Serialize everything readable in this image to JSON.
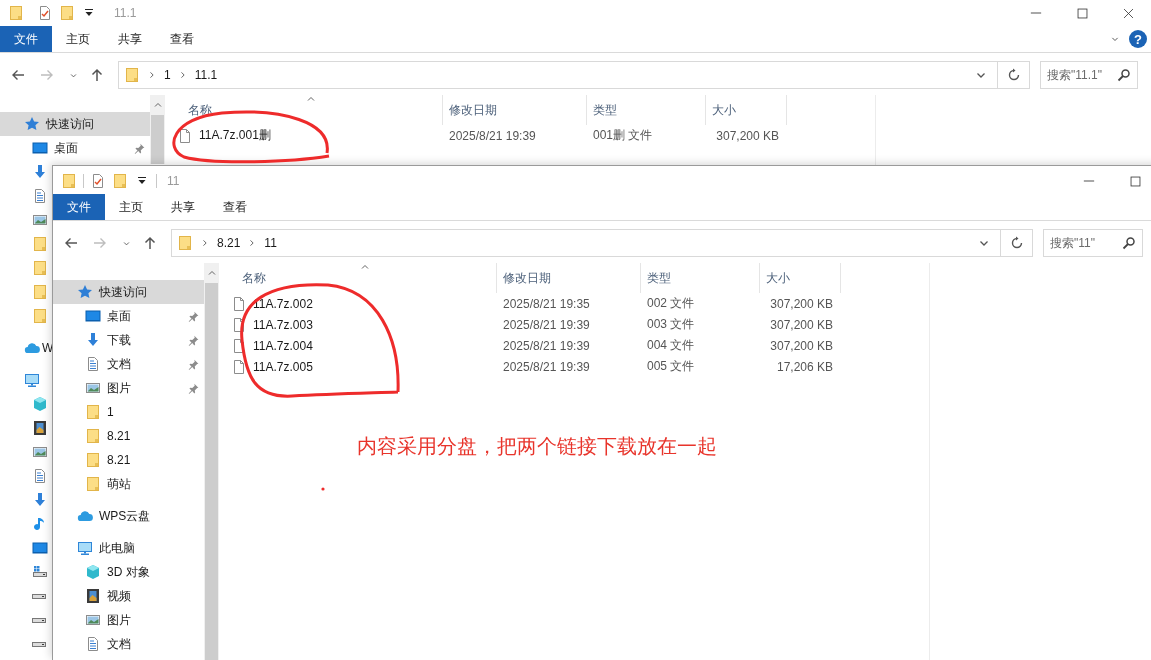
{
  "windows": [
    {
      "title": "11.1",
      "controls": [
        {
          "kind": "minimize"
        },
        {
          "kind": "maximize"
        },
        {
          "kind": "close"
        }
      ],
      "ribbon_tabs": [
        {
          "label": "文件",
          "selected": true
        },
        {
          "label": "主页",
          "selected": false
        },
        {
          "label": "共享",
          "selected": false
        },
        {
          "label": "查看",
          "selected": false
        }
      ],
      "help": "?",
      "address": [
        "1",
        "11.1"
      ],
      "search": {
        "placeholder": "搜索\"11.1\""
      },
      "nav": [
        {
          "kind": "star",
          "label": "快速访问",
          "selected": true,
          "children": [
            {
              "kind": "desktop",
              "label": "桌面",
              "pinned": true,
              "selected": false
            },
            {
              "kind": "download",
              "selected": false
            },
            {
              "kind": "doc",
              "selected": false
            },
            {
              "kind": "picture",
              "selected": false
            },
            {
              "kind": "folder",
              "selected": false
            },
            {
              "kind": "folder",
              "selected": false
            },
            {
              "kind": "folder",
              "selected": false
            },
            {
              "kind": "folder",
              "selected": false
            }
          ]
        },
        {
          "kind": "cloud",
          "label": "W",
          "selected": false
        },
        {
          "kind": "pc",
          "selected": false,
          "children": [
            {
              "kind": "cube",
              "selected": false
            },
            {
              "kind": "video",
              "selected": false
            },
            {
              "kind": "picture",
              "selected": false
            },
            {
              "kind": "doc",
              "selected": false
            },
            {
              "kind": "download",
              "selected": false
            },
            {
              "kind": "music",
              "selected": false
            },
            {
              "kind": "desktop",
              "selected": false
            },
            {
              "kind": "drive-win",
              "selected": false
            },
            {
              "kind": "drive",
              "selected": false
            },
            {
              "kind": "drive",
              "selected": false
            },
            {
              "kind": "drive",
              "selected": false
            }
          ]
        }
      ],
      "columns": [
        "名称",
        "修改日期",
        "类型",
        "大小"
      ],
      "files": [
        {
          "name": "11A.7z.001删",
          "modified": "2025/8/21 19:39",
          "type": "001删 文件",
          "size": "307,200 KB"
        }
      ]
    },
    {
      "title": "11",
      "controls": [
        {
          "kind": "minimize"
        },
        {
          "kind": "maximize"
        }
      ],
      "ribbon_tabs": [
        {
          "label": "文件",
          "selected": true
        },
        {
          "label": "主页",
          "selected": false
        },
        {
          "label": "共享",
          "selected": false
        },
        {
          "label": "查看",
          "selected": false
        }
      ],
      "address": [
        "8.21",
        "11"
      ],
      "search": {
        "placeholder": "搜索\"11\""
      },
      "nav": [
        {
          "kind": "star",
          "label": "快速访问",
          "selected": true,
          "children": [
            {
              "kind": "desktop",
              "label": "桌面",
              "pinned": true,
              "selected": false
            },
            {
              "kind": "download",
              "label": "下载",
              "pinned": true,
              "selected": false
            },
            {
              "kind": "doc",
              "label": "文档",
              "pinned": true,
              "selected": false
            },
            {
              "kind": "picture",
              "label": "图片",
              "pinned": true,
              "selected": false
            },
            {
              "kind": "folder",
              "label": "1",
              "pinned": false,
              "selected": false
            },
            {
              "kind": "folder",
              "label": "8.21",
              "pinned": false,
              "selected": false
            },
            {
              "kind": "folder",
              "label": "8.21",
              "pinned": false,
              "selected": false
            },
            {
              "kind": "folder",
              "label": "萌站",
              "pinned": false,
              "selected": false
            }
          ]
        },
        {
          "kind": "cloud",
          "label": "WPS云盘",
          "selected": false
        },
        {
          "kind": "pc",
          "label": "此电脑",
          "selected": false,
          "children": [
            {
              "kind": "cube",
              "label": "3D 对象",
              "selected": false
            },
            {
              "kind": "video",
              "label": "视频",
              "selected": false
            },
            {
              "kind": "picture",
              "label": "图片",
              "selected": false
            },
            {
              "kind": "doc",
              "label": "文档",
              "selected": false
            }
          ]
        }
      ],
      "columns": [
        "名称",
        "修改日期",
        "类型",
        "大小"
      ],
      "files": [
        {
          "name": "11A.7z.002",
          "modified": "2025/8/21 19:35",
          "type": "002 文件",
          "size": "307,200 KB"
        },
        {
          "name": "11A.7z.003",
          "modified": "2025/8/21 19:39",
          "type": "003 文件",
          "size": "307,200 KB"
        },
        {
          "name": "11A.7z.004",
          "modified": "2025/8/21 19:39",
          "type": "004 文件",
          "size": "307,200 KB"
        },
        {
          "name": "11A.7z.005",
          "modified": "2025/8/21 19:39",
          "type": "005 文件",
          "size": "17,206 KB"
        }
      ]
    }
  ],
  "annotation": {
    "note": "内容采用分盘，把两个链接下载放在一起"
  }
}
